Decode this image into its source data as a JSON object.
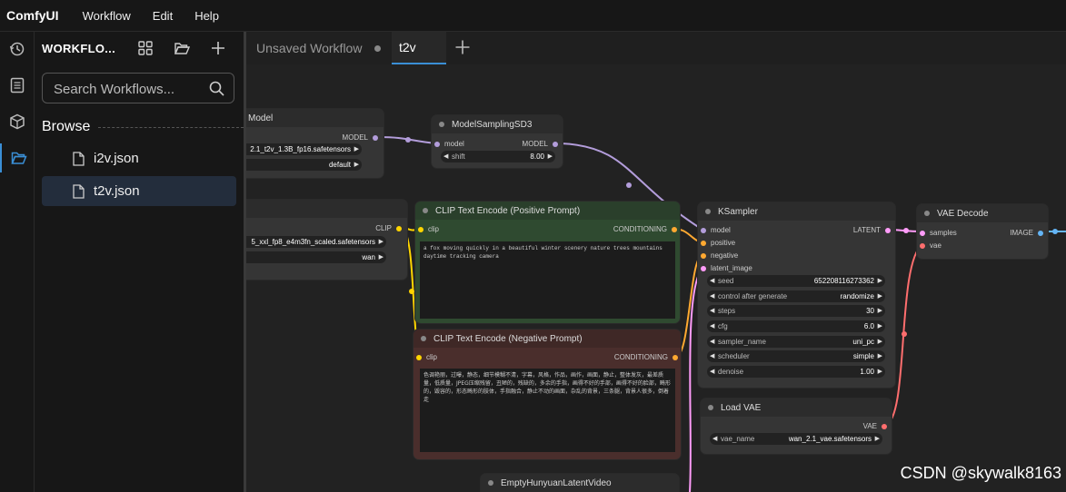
{
  "app": {
    "brand": "ComfyUI",
    "menu": [
      "Workflow",
      "Edit",
      "Help"
    ]
  },
  "sidebar": {
    "title": "WORKFLO...",
    "search_placeholder": "Search Workflows...",
    "browse_label": "Browse",
    "files": [
      "i2v.json",
      "t2v.json"
    ],
    "selected_file": "t2v.json"
  },
  "tabs": [
    {
      "label": "Unsaved Workflow",
      "active": false,
      "modified": true
    },
    {
      "label": "t2v",
      "active": true
    }
  ],
  "nodes": {
    "load_model": {
      "title": "Model",
      "output": "MODEL",
      "widgets": [
        {
          "value": "2.1_t2v_1.3B_fp16.safetensors"
        },
        {
          "value": "default"
        }
      ]
    },
    "model_sampling": {
      "title": "ModelSamplingSD3",
      "input": "model",
      "output": "MODEL",
      "widget": {
        "label": "shift",
        "value": "8.00"
      }
    },
    "load_clip": {
      "output": "CLIP",
      "widgets": [
        {
          "value": "5_xxl_fp8_e4m3fn_scaled.safetensors"
        },
        {
          "value": "wan"
        }
      ]
    },
    "clip_positive": {
      "title": "CLIP Text Encode (Positive Prompt)",
      "input": "clip",
      "output": "CONDITIONING",
      "text": "a fox moving quickly in a beautiful winter scenery nature trees mountains daytime tracking camera"
    },
    "clip_negative": {
      "title": "CLIP Text Encode (Negative Prompt)",
      "input": "clip",
      "output": "CONDITIONING",
      "text": "色调艳丽，过曝，静态，细节模糊不清，字幕，风格，作品，画作，画面，静止，整体发灰，最差质量，低质量，JPEG压缩残留，丑陋的，残缺的，多余的手指，画得不好的手部，画得不好的脸部，畸形的，毁容的，形态畸形的肢体，手指融合，静止不动的画面，杂乱的背景，三条腿，背景人很多，倒着走"
    },
    "ksampler": {
      "title": "KSampler",
      "inputs": [
        "model",
        "positive",
        "negative",
        "latent_image"
      ],
      "output": "LATENT",
      "widgets": [
        {
          "label": "seed",
          "value": "652208116273362"
        },
        {
          "label": "control after generate",
          "value": "randomize"
        },
        {
          "label": "steps",
          "value": "30"
        },
        {
          "label": "cfg",
          "value": "6.0"
        },
        {
          "label": "sampler_name",
          "value": "uni_pc"
        },
        {
          "label": "scheduler",
          "value": "simple"
        },
        {
          "label": "denoise",
          "value": "1.00"
        }
      ]
    },
    "vae_decode": {
      "title": "VAE Decode",
      "inputs": [
        "samples",
        "vae"
      ],
      "output": "IMAGE"
    },
    "load_vae": {
      "title": "Load VAE",
      "output": "VAE",
      "widget": {
        "label": "vae_name",
        "value": "wan_2.1_vae.safetensors"
      }
    },
    "empty_latent": {
      "title": "EmptyHunyuanLatentVideo"
    }
  },
  "colors": {
    "accent": "#3a8fd6",
    "model_link": "#b39ddb",
    "clip_link": "#ffd500",
    "conditioning_link": "#ffa931",
    "latent_link": "#ff9cf9",
    "vae_link": "#ff6e6e",
    "image_link": "#64b5f6",
    "positive_node": "#2f4a30",
    "negative_node": "#4a2e2c"
  },
  "watermark": "CSDN @skywalk8163"
}
